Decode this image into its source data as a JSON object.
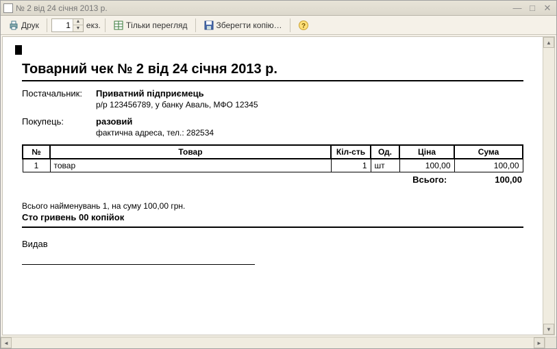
{
  "window": {
    "title": "№ 2 від 24 січня 2013 р."
  },
  "toolbar": {
    "print_label": "Друк",
    "copies_value": "1",
    "copies_suffix": "екз.",
    "view_only_label": "Тільки перегляд",
    "save_copy_label": "Зберегти копію…"
  },
  "doc": {
    "title": "Товарний чек № 2 від 24 січня 2013 р.",
    "supplier_label": "Постачальник:",
    "supplier_name": "Приватний підприємець",
    "supplier_details": "р/р 123456789,  у банку Аваль,  МФО 12345",
    "buyer_label": "Покупець:",
    "buyer_name": "разовий",
    "buyer_details": "фактична адреса,  тел.: 282534",
    "cols": {
      "n": "№",
      "item": "Товар",
      "qty": "Кіл-сть",
      "unit": "Од.",
      "price": "Ціна",
      "sum": "Сума"
    },
    "rows": [
      {
        "n": "1",
        "item": "товар",
        "qty": "1",
        "unit": "шт",
        "price": "100,00",
        "sum": "100,00"
      }
    ],
    "total_label": "Всього:",
    "total_value": "100,00",
    "summary_line": "Всього найменувань 1, на суму 100,00 грн.",
    "amount_words": "Сто гривень 00 копійок",
    "issuer_label": "Видав"
  }
}
